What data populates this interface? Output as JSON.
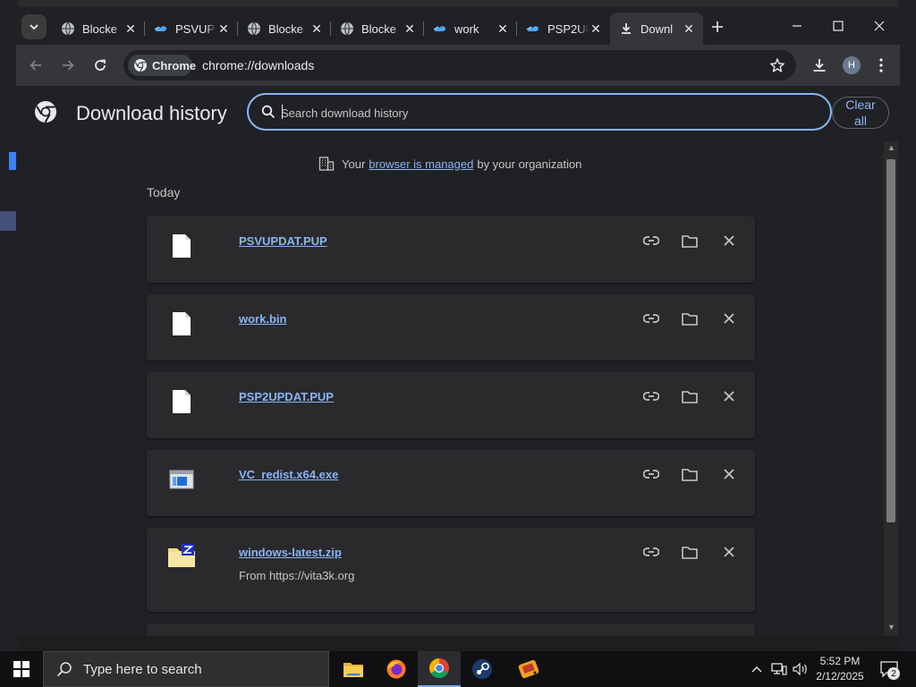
{
  "tabs": [
    {
      "title": "Blocke",
      "icon": "globe-icon"
    },
    {
      "title": "PSVUPD",
      "icon": "cloud-icon"
    },
    {
      "title": "Blocke",
      "icon": "globe-icon"
    },
    {
      "title": "Blocke",
      "icon": "globe-icon"
    },
    {
      "title": "work",
      "icon": "cloud-icon"
    },
    {
      "title": "PSP2UP",
      "icon": "cloud-icon"
    },
    {
      "title": "Downl",
      "icon": "download-icon",
      "active": true
    }
  ],
  "toolbar": {
    "chip_label": "Chrome",
    "url": "chrome://downloads",
    "avatar_initial": "H"
  },
  "page": {
    "title": "Download history",
    "search_placeholder": "Search download history",
    "clear_all_line1": "Clear",
    "clear_all_line2": "all",
    "managed_prefix": "Your",
    "managed_link": "browser is managed",
    "managed_suffix": "by your organization",
    "day_label": "Today"
  },
  "downloads": [
    {
      "name": "PSVUPDAT.PUP",
      "type": "file",
      "from": ""
    },
    {
      "name": "work.bin",
      "type": "file",
      "from": ""
    },
    {
      "name": "PSP2UPDAT.PUP",
      "type": "file",
      "from": ""
    },
    {
      "name": "VC_redist.x64.exe",
      "type": "exe",
      "from": ""
    },
    {
      "name": "windows-latest.zip",
      "type": "zip",
      "from": "From https://vita3k.org"
    }
  ],
  "taskbar": {
    "search_placeholder": "Type here to search",
    "time": "5:52 PM",
    "date": "2/12/2025",
    "notification_count": "2"
  },
  "colors": {
    "accent": "#8ab4f8",
    "background": "#202124",
    "card": "#2a2a2d",
    "toolbar": "#35363a"
  }
}
